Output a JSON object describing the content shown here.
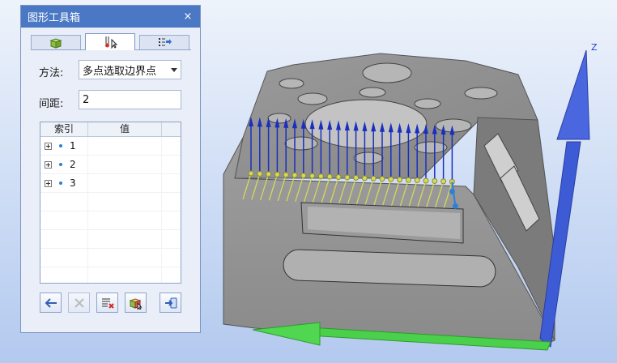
{
  "panel": {
    "title": "图形工具箱",
    "close_label": "×",
    "tabs": [
      {
        "icon": "solid-box-icon",
        "active": false
      },
      {
        "icon": "pick-points-icon",
        "active": true
      },
      {
        "icon": "list-arrow-icon",
        "active": false
      }
    ],
    "method": {
      "label": "方法:",
      "value": "多点选取边界点"
    },
    "spacing": {
      "label": "间距:",
      "value": "2"
    },
    "table": {
      "headers": [
        "索引",
        "值"
      ],
      "rows": [
        {
          "index": "1",
          "value": ""
        },
        {
          "index": "2",
          "value": ""
        },
        {
          "index": "3",
          "value": ""
        }
      ]
    },
    "toolbar": [
      {
        "icon": "back-arrow-icon",
        "enabled": true
      },
      {
        "icon": "delete-x-icon",
        "enabled": false
      },
      {
        "icon": "clear-list-icon",
        "enabled": true
      },
      {
        "icon": "select-solid-icon",
        "enabled": true
      },
      {
        "icon": "export-icon",
        "enabled": true
      }
    ]
  },
  "viewport": {
    "axis_label": "Z",
    "colors": {
      "part": "#8f8f8f",
      "z_axis": "#3e5bd6",
      "x_axis": "#4bd04b",
      "normal_arrows": "#1a2fbf",
      "points": "#d6d85a",
      "selected_point": "#2f7fd8"
    }
  }
}
